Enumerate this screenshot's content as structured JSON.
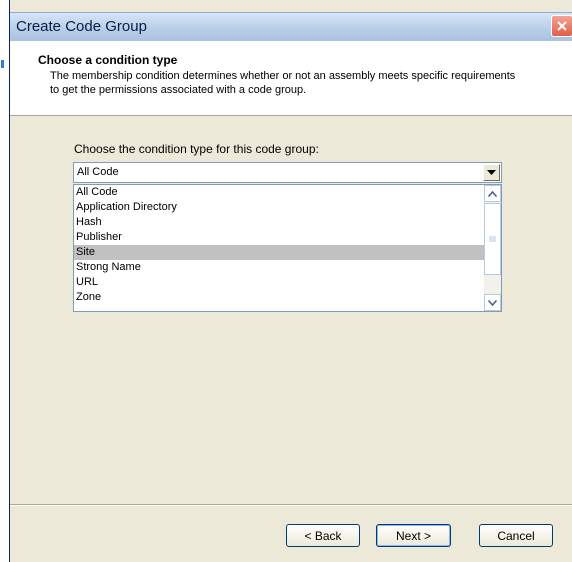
{
  "window": {
    "title": "Create Code Group"
  },
  "header": {
    "title": "Choose a condition type",
    "description": "The membership condition determines whether or not an assembly meets specific requirements to get the permissions associated with a code group."
  },
  "content": {
    "label": "Choose the condition type for this code group:",
    "combo_value": "All Code",
    "options": [
      "All Code",
      "Application Directory",
      "Hash",
      "Publisher",
      "Site",
      "Strong Name",
      "URL",
      "Zone"
    ],
    "selected": "Site"
  },
  "buttons": {
    "back": "< Back",
    "next": "Next >",
    "cancel": "Cancel"
  },
  "colors": {
    "selection": "#c1c1c1",
    "close": "#e06048"
  }
}
